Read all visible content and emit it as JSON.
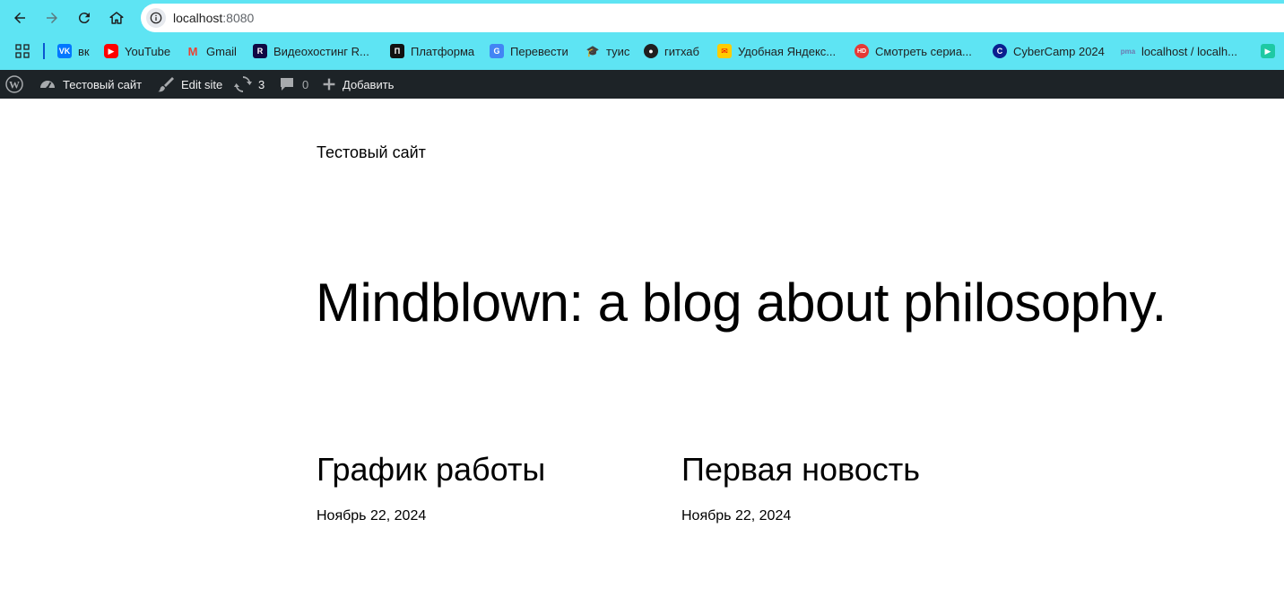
{
  "browser": {
    "url_host": "localhost",
    "url_port": ":8080",
    "bookmarks": [
      {
        "label": "вк",
        "icon": "vk-icon"
      },
      {
        "label": "YouTube",
        "icon": "youtube-icon"
      },
      {
        "label": "Gmail",
        "icon": "gmail-icon"
      },
      {
        "label": "Видеохостинг R...",
        "icon": "rutube-icon"
      },
      {
        "label": "Платформа",
        "icon": "platform-icon"
      },
      {
        "label": "Перевести",
        "icon": "translate-icon"
      },
      {
        "label": "туис",
        "icon": "tuis-icon"
      },
      {
        "label": "гитхаб",
        "icon": "github-icon"
      },
      {
        "label": "Удобная Яндекс...",
        "icon": "yandex-mail-icon"
      },
      {
        "label": "Смотреть сериа...",
        "icon": "hd-icon"
      },
      {
        "label": "CyberCamp 2024",
        "icon": "cybercamp-icon"
      },
      {
        "label": "localhost / localh...",
        "icon": "phpmyadmin-icon"
      }
    ]
  },
  "adminbar": {
    "site_name": "Тестовый сайт",
    "edit_site": "Edit site",
    "updates_count": "3",
    "comments_count": "0",
    "add_new": "Добавить"
  },
  "site": {
    "title": "Тестовый сайт",
    "tagline": "Mindblown: a blog about philosophy."
  },
  "posts": [
    {
      "title": "График работы",
      "date": "Ноябрь 22, 2024"
    },
    {
      "title": "Первая новость",
      "date": "Ноябрь 22, 2024"
    }
  ],
  "colors": {
    "chrome_bg": "#5ee4f3",
    "adminbar_bg": "#1d2327"
  }
}
